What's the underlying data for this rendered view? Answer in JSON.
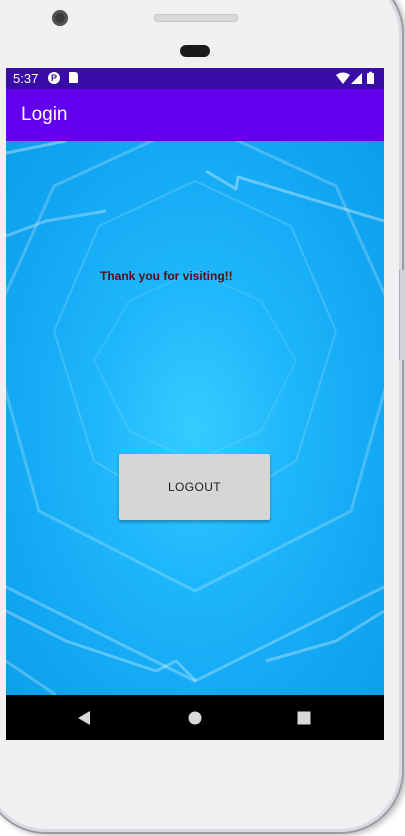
{
  "status_bar": {
    "time": "5:37",
    "icons": [
      "p-notification-icon",
      "sd-card-icon",
      "wifi-icon",
      "signal-icon",
      "battery-icon"
    ]
  },
  "app_bar": {
    "title": "Login",
    "color": "#6200ee"
  },
  "main": {
    "message": "Thank you for visiting!!",
    "logout_label": "LOGOUT"
  },
  "nav_bar": {
    "buttons": [
      "back-icon",
      "home-icon",
      "recents-icon"
    ]
  },
  "colors": {
    "status_bar": "#3a0ca7",
    "app_bar": "#6200ee",
    "background": "#1eb6fb",
    "message_text": "#5a0a14",
    "button": "#d6d6d6"
  }
}
